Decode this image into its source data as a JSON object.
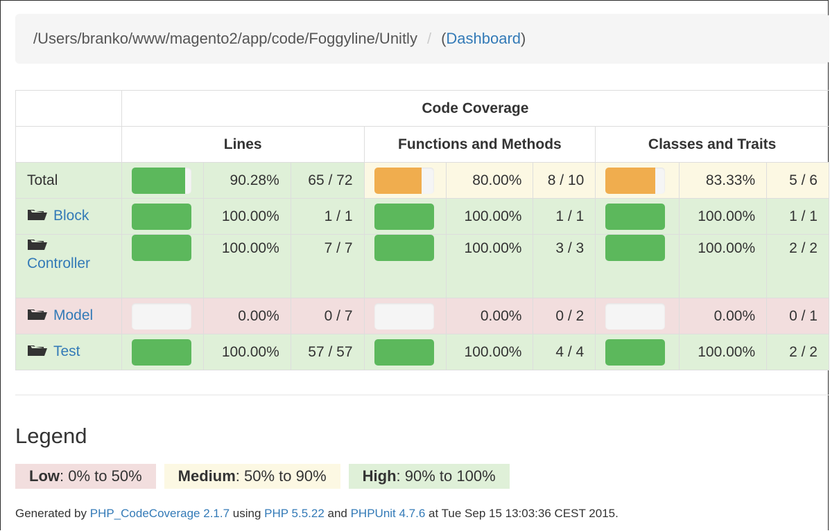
{
  "breadcrumb": {
    "path": "/Users/branko/www/magento2/app/code/Foggyline/Unitly",
    "separator": "/",
    "open_paren": "(",
    "link": "Dashboard",
    "close_paren": ")"
  },
  "table": {
    "group_header": "Code Coverage",
    "columns": [
      "Lines",
      "Functions and Methods",
      "Classes and Traits"
    ],
    "rows": [
      {
        "name": "Total",
        "link": false,
        "lines": {
          "pct": "90.28%",
          "ratio": "65 / 72",
          "fill": 90.28,
          "level": "success"
        },
        "functions": {
          "pct": "80.00%",
          "ratio": "8 / 10",
          "fill": 80.0,
          "level": "warning"
        },
        "classes": {
          "pct": "83.33%",
          "ratio": "5 / 6",
          "fill": 83.33,
          "level": "warning"
        },
        "level": "success"
      },
      {
        "name": "Block",
        "link": true,
        "lines": {
          "pct": "100.00%",
          "ratio": "1 / 1",
          "fill": 100,
          "level": "success"
        },
        "functions": {
          "pct": "100.00%",
          "ratio": "1 / 1",
          "fill": 100,
          "level": "success"
        },
        "classes": {
          "pct": "100.00%",
          "ratio": "1 / 1",
          "fill": 100,
          "level": "success"
        },
        "level": "success"
      },
      {
        "name": "Controller",
        "link": true,
        "lines": {
          "pct": "100.00%",
          "ratio": "7 / 7",
          "fill": 100,
          "level": "success"
        },
        "functions": {
          "pct": "100.00%",
          "ratio": "3 / 3",
          "fill": 100,
          "level": "success"
        },
        "classes": {
          "pct": "100.00%",
          "ratio": "2 / 2",
          "fill": 100,
          "level": "success"
        },
        "level": "success"
      },
      {
        "name": "Model",
        "link": true,
        "lines": {
          "pct": "0.00%",
          "ratio": "0 / 7",
          "fill": 0,
          "level": "danger"
        },
        "functions": {
          "pct": "0.00%",
          "ratio": "0 / 2",
          "fill": 0,
          "level": "danger"
        },
        "classes": {
          "pct": "0.00%",
          "ratio": "0 / 1",
          "fill": 0,
          "level": "danger"
        },
        "level": "danger"
      },
      {
        "name": "Test",
        "link": true,
        "lines": {
          "pct": "100.00%",
          "ratio": "57 / 57",
          "fill": 100,
          "level": "success"
        },
        "functions": {
          "pct": "100.00%",
          "ratio": "4 / 4",
          "fill": 100,
          "level": "success"
        },
        "classes": {
          "pct": "100.00%",
          "ratio": "2 / 2",
          "fill": 100,
          "level": "success"
        },
        "level": "success"
      }
    ]
  },
  "legend": {
    "title": "Legend",
    "low_label": "Low",
    "low_range": ": 0% to 50%",
    "medium_label": "Medium",
    "medium_range": ": 50% to 90%",
    "high_label": "High",
    "high_range": ": 90% to 100%"
  },
  "footer": {
    "prefix": "Generated by ",
    "tool_link": "PHP_CodeCoverage 2.1.7",
    "using": " using ",
    "php_link": "PHP 5.5.22",
    "and": " and ",
    "phpunit_link": "PHPUnit 4.7.6",
    "suffix": " at Tue Sep 15 13:03:36 CEST 2015."
  },
  "colors": {
    "success_bg": "#dff0d8",
    "warning_bg": "#fcf8e3",
    "danger_bg": "#f2dede",
    "bar_green": "#5cb85c",
    "bar_orange": "#f0ad4e",
    "link": "#337ab7"
  }
}
